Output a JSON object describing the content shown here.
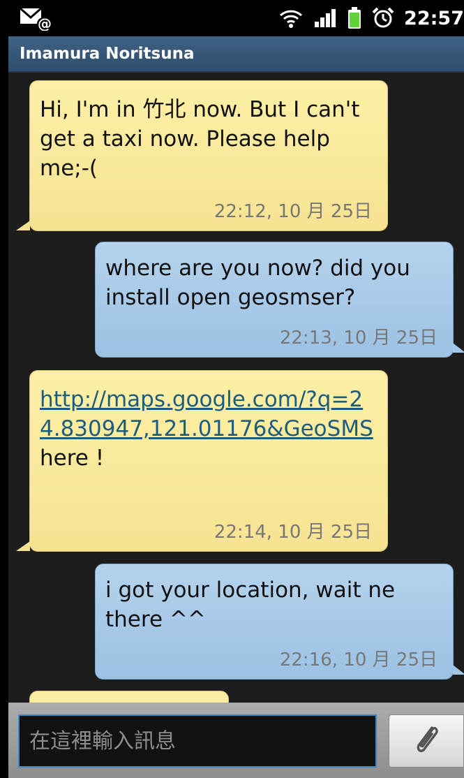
{
  "status_bar": {
    "time": "22:57",
    "icons": [
      "email-notification-icon",
      "wifi-icon",
      "signal-icon",
      "battery-icon",
      "alarm-icon"
    ]
  },
  "header": {
    "contact_name": "Imamura Noritsuna"
  },
  "messages": [
    {
      "direction": "incoming",
      "text": "Hi, I'm in 竹北 now. But I can't get a taxi now. Please help me;-(",
      "time": "22:12, 10 月 25日"
    },
    {
      "direction": "outgoing",
      "text": "where are you now? did you install open geosmser?",
      "time": "22:13, 10 月 25日"
    },
    {
      "direction": "incoming",
      "link": "http://maps.google.com/?q=24.830947,121.01176&GeoSMS",
      "text": "here !",
      "time": "22:14, 10 月 25日"
    },
    {
      "direction": "outgoing",
      "text": "i got your location, wait ne there ^^",
      "time": "22:16, 10 月 25日"
    }
  ],
  "composer": {
    "placeholder": "在這裡輸入訊息",
    "attach_icon": "paperclip-icon"
  },
  "colors": {
    "incoming_bubble": "#f6e392",
    "outgoing_bubble": "#9cc1e3",
    "title_bar": "#2f4d6c",
    "link": "#1d5b7f",
    "input_focus_border": "#3b87c7"
  }
}
